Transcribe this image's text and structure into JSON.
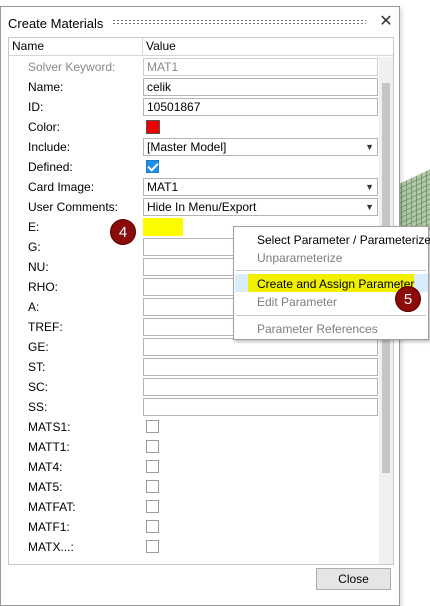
{
  "dialog": {
    "title": "Create Materials",
    "close_label": "Close"
  },
  "grid": {
    "columns": [
      "Name",
      "Value"
    ],
    "rows": [
      {
        "label": "Solver Keyword:",
        "type": "text",
        "value": "MAT1",
        "disabled": true
      },
      {
        "label": "Name:",
        "type": "text",
        "value": "celik"
      },
      {
        "label": "ID:",
        "type": "text",
        "value": "10501867"
      },
      {
        "label": "Color:",
        "type": "color",
        "value": "#ee0000"
      },
      {
        "label": "Include:",
        "type": "select",
        "value": "[Master Model]"
      },
      {
        "label": "Defined:",
        "type": "checkbox",
        "checked": true
      },
      {
        "label": "Card Image:",
        "type": "select",
        "value": "MAT1"
      },
      {
        "label": "User Comments:",
        "type": "select",
        "value": "Hide In Menu/Export"
      },
      {
        "label": "E:",
        "type": "text",
        "value": "",
        "highlight": true
      },
      {
        "label": "G:",
        "type": "text",
        "value": ""
      },
      {
        "label": "NU:",
        "type": "text",
        "value": ""
      },
      {
        "label": "RHO:",
        "type": "text",
        "value": ""
      },
      {
        "label": "A:",
        "type": "text",
        "value": ""
      },
      {
        "label": "TREF:",
        "type": "text",
        "value": ""
      },
      {
        "label": "GE:",
        "type": "text",
        "value": ""
      },
      {
        "label": "ST:",
        "type": "text",
        "value": ""
      },
      {
        "label": "SC:",
        "type": "text",
        "value": ""
      },
      {
        "label": "SS:",
        "type": "text",
        "value": ""
      },
      {
        "label": "MATS1:",
        "type": "checkbox",
        "checked": false
      },
      {
        "label": "MATT1:",
        "type": "checkbox",
        "checked": false
      },
      {
        "label": "MAT4:",
        "type": "checkbox",
        "checked": false
      },
      {
        "label": "MAT5:",
        "type": "checkbox",
        "checked": false
      },
      {
        "label": "MATFAT:",
        "type": "checkbox",
        "checked": false
      },
      {
        "label": "MATF1:",
        "type": "checkbox",
        "checked": false
      },
      {
        "label": "MATX...:",
        "type": "checkbox",
        "checked": false
      }
    ]
  },
  "context_menu": {
    "items": [
      {
        "label": "Select Parameter / Parameterize",
        "disabled": false
      },
      {
        "label": "Unparameterize",
        "disabled": true
      },
      {
        "label": "Create and Assign Parameter",
        "disabled": false,
        "highlighted": true
      },
      {
        "label": "Edit Parameter",
        "disabled": true
      },
      {
        "label": "Parameter References",
        "disabled": true
      }
    ]
  },
  "annotations": {
    "step_a": "4",
    "step_b": "5"
  },
  "colors": {
    "highlight": "#f0f000",
    "badge": "#8b0a0a",
    "checkbox_checked": "#1e90e8"
  }
}
